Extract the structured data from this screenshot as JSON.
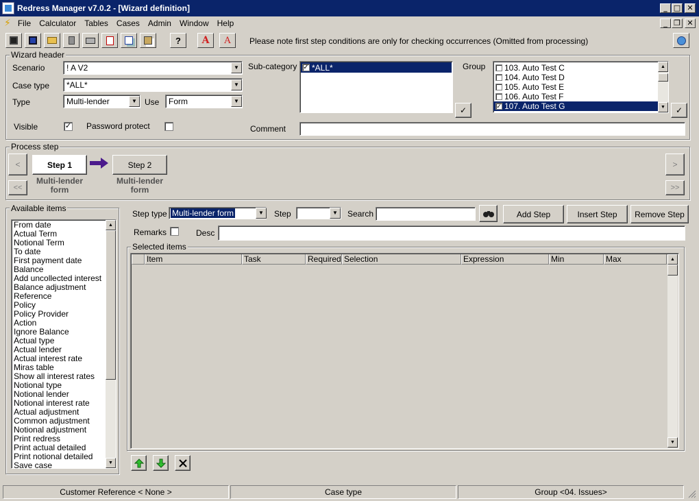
{
  "window": {
    "title": "Redress Manager v7.0.2 - [Wizard definition]",
    "controls": {
      "minimize": "_",
      "maximize": "□",
      "close": "✕",
      "restore": "❐"
    }
  },
  "menu": {
    "items": [
      {
        "label": "File"
      },
      {
        "label": "Calculator"
      },
      {
        "label": "Tables"
      },
      {
        "label": "Cases"
      },
      {
        "label": "Admin"
      },
      {
        "label": "Window"
      },
      {
        "label": "Help"
      }
    ]
  },
  "toolbar": {
    "notice": "Please note first step conditions are only for checking occurrences (Omitted from processing)",
    "buttons": [
      "save-icon",
      "save-as-icon",
      "open-folder-icon",
      "delete-icon",
      "print-icon",
      "pdf-icon",
      "copy-icon",
      "paste-icon",
      "help-icon",
      "font-increase-icon",
      "font-decrease-icon"
    ]
  },
  "wizard_header": {
    "label": "Wizard header",
    "scenario_label": "Scenario",
    "scenario_value": "! A V2",
    "case_type_label": "Case type",
    "case_type_value": "*ALL*",
    "type_label": "Type",
    "type_value": "Multi-lender",
    "use_label": "Use",
    "use_value": "Form",
    "visible_label": "Visible",
    "visible_checked": "✓",
    "password_label": "Password protect",
    "subcategory_label": "Sub-category",
    "subcategory_items": [
      {
        "label": "*ALL*",
        "check": "✓"
      }
    ],
    "group_label": "Group",
    "group_items": [
      {
        "label": "103. Auto Test C",
        "check": ""
      },
      {
        "label": "104. Auto Test D",
        "check": ""
      },
      {
        "label": "105. Auto Test E",
        "check": ""
      },
      {
        "label": "106. Auto Test F",
        "check": ""
      },
      {
        "label": "107. Auto Test G",
        "check": "✓"
      }
    ],
    "comment_label": "Comment",
    "comment_value": "",
    "confirm_mark": "✓"
  },
  "process_step": {
    "label": "Process step",
    "nav": {
      "prev": "<",
      "first": "<<",
      "next": ">",
      "last": ">>"
    },
    "steps": [
      {
        "label": "Step 1",
        "caption_line1": "Multi-lender",
        "caption_line2": "form"
      },
      {
        "label": "Step 2",
        "caption_line1": "Multi-lender",
        "caption_line2": "form"
      }
    ]
  },
  "available_items": {
    "label": "Available items",
    "items": [
      "From date",
      "Actual Term",
      "Notional Term",
      "To date",
      "First payment date",
      "Balance",
      "Add uncollected interest",
      "Balance adjustment",
      "Reference",
      "Policy",
      "Policy Provider",
      "Action",
      "Ignore Balance",
      "Actual type",
      "Actual lender",
      "Actual interest rate",
      "Miras table",
      "Show all interest rates",
      "Notional type",
      "Notional lender",
      "Notional interest rate",
      "Actual adjustment",
      "Common adjustment",
      "Notional adjustment",
      "Print redress",
      "Print actual detailed",
      "Print notional detailed",
      "Save case"
    ]
  },
  "step_editor": {
    "step_type_label": "Step type",
    "step_type_value": "Multi-lender form",
    "step_label": "Step",
    "step_value": "",
    "search_label": "Search",
    "search_value": "",
    "add_step": "Add Step",
    "insert_step": "Insert Step",
    "remove_step": "Remove Step",
    "remarks_label": "Remarks",
    "desc_label": "Desc",
    "desc_value": ""
  },
  "selected_items": {
    "label": "Selected items",
    "columns": [
      "Item",
      "Task",
      "Required",
      "Selection",
      "Expression",
      "Min",
      "Max"
    ]
  },
  "statusbar": {
    "customer_reference": "Customer Reference < None >",
    "case_type": "Case type",
    "group": "Group <04. Issues>"
  }
}
